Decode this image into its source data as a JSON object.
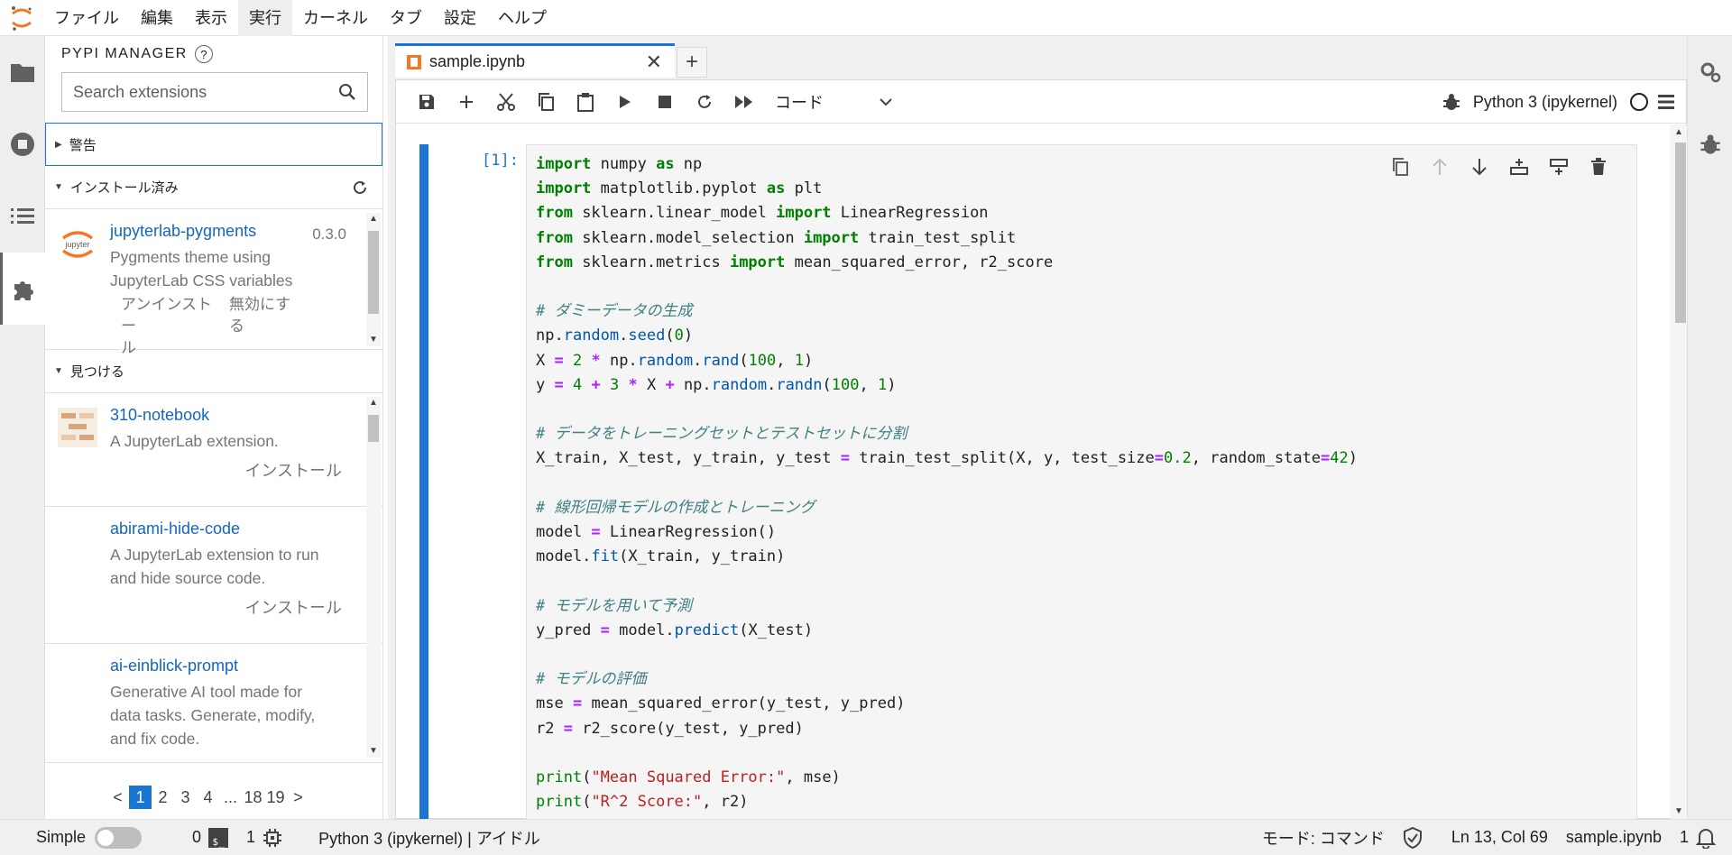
{
  "menubar": {
    "items": [
      "ファイル",
      "編集",
      "表示",
      "実行",
      "カーネル",
      "タブ",
      "設定",
      "ヘルプ"
    ],
    "active_index": 3
  },
  "leftbar": {
    "icons": [
      "folder-icon",
      "running-icon",
      "toc-icon",
      "extension-icon"
    ],
    "active": "extension-icon"
  },
  "extension_manager": {
    "title": "PYPI MANAGER",
    "help_glyph": "?",
    "search_placeholder": "Search extensions",
    "warnings_section": "警告",
    "installed_section": "インストール済み",
    "installed": [
      {
        "name": "jupyterlab-pygments",
        "version": "0.3.0",
        "description_lines": [
          "Pygments theme using",
          "JupyterLab CSS variables"
        ],
        "uninstall_lines": [
          "アンインストー",
          "ル"
        ],
        "disable_lines": [
          "無効にす",
          "る"
        ]
      }
    ],
    "discover_section": "見つける",
    "discover": [
      {
        "name": "310-notebook",
        "description_lines": [
          "A JupyterLab extension."
        ],
        "install_label": "インストール"
      },
      {
        "name": "abirami-hide-code",
        "description_lines": [
          "A JupyterLab extension to run",
          "and hide source code."
        ],
        "install_label": "インストール"
      },
      {
        "name": "ai-einblick-prompt",
        "description_lines": [
          "Generative AI tool made for",
          "data tasks. Generate, modify,",
          "and fix code."
        ]
      }
    ],
    "pagination": {
      "prev": "<",
      "pages": [
        "1",
        "2",
        "3",
        "4",
        "...",
        "18",
        "19"
      ],
      "current": "1",
      "next": ">"
    }
  },
  "tab": {
    "title": "sample.ipynb",
    "close_glyph": "✕",
    "new_tab_glyph": "+"
  },
  "toolbar": {
    "cell_type": "コード",
    "kernel_name": "Python 3 (ipykernel)"
  },
  "cell": {
    "prompt": "[1]:",
    "code_lines": [
      "import numpy as np",
      "import matplotlib.pyplot as plt",
      "from sklearn.linear_model import LinearRegression",
      "from sklearn.model_selection import train_test_split",
      "from sklearn.metrics import mean_squared_error, r2_score",
      "",
      "# ダミーデータの生成",
      "np.random.seed(0)",
      "X = 2 * np.random.rand(100, 1)",
      "y = 4 + 3 * X + np.random.randn(100, 1)",
      "",
      "# データをトレーニングセットとテストセットに分割",
      "X_train, X_test, y_train, y_test = train_test_split(X, y, test_size=0.2, random_state=42)",
      "",
      "# 線形回帰モデルの作成とトレーニング",
      "model = LinearRegression()",
      "model.fit(X_train, y_train)",
      "",
      "# モデルを用いて予測",
      "y_pred = model.predict(X_test)",
      "",
      "# モデルの評価",
      "mse = mean_squared_error(y_test, y_pred)",
      "r2 = r2_score(y_test, y_pred)",
      "",
      "print(\"Mean Squared Error:\", mse)",
      "print(\"R^2 Score:\", r2)"
    ]
  },
  "statusbar": {
    "simple_label": "Simple",
    "terminals_count": "0",
    "terminal_glyph": "$_",
    "kernels_count": "1",
    "kernel_status": "Python 3 (ipykernel) | アイドル",
    "mode": "モード: コマンド",
    "cursor": "Ln 13, Col 69",
    "filename": "sample.ipynb",
    "notifications": "1"
  },
  "colors": {
    "accent": "#1976d2",
    "jupyter_orange": "#f37726"
  }
}
